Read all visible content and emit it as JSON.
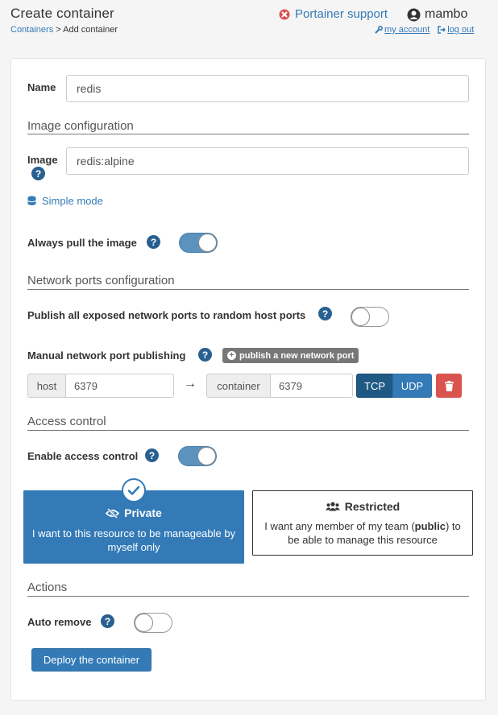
{
  "header": {
    "title": "Create container",
    "breadcrumb_link": "Containers",
    "breadcrumb_sep": ">",
    "breadcrumb_current": "Add container",
    "support": "Portainer support",
    "username": "mambo",
    "my_account": "my account",
    "log_out": "log out"
  },
  "form": {
    "name_label": "Name",
    "name_value": "redis",
    "image_section": "Image configuration",
    "image_label": "Image",
    "image_value": "redis:alpine",
    "simple_mode": "Simple mode",
    "always_pull_label": "Always pull the image",
    "always_pull": true
  },
  "network": {
    "section": "Network ports configuration",
    "publish_all_label": "Publish all exposed network ports to random host ports",
    "publish_all": false,
    "manual_label": "Manual network port publishing",
    "add_port": "publish a new network port",
    "ports": [
      {
        "host_label": "host",
        "host_value": "6379",
        "arrow": "→",
        "container_label": "container",
        "container_value": "6379",
        "tcp": "TCP",
        "udp": "UDP",
        "selected_protocol": "TCP"
      }
    ]
  },
  "access": {
    "section": "Access control",
    "enable_label": "Enable access control",
    "enabled": true,
    "private_title": "Private",
    "private_desc": "I want to this resource to be manageable by myself only",
    "restricted_title": "Restricted",
    "restricted_desc_1": "I want any member of my team (",
    "restricted_desc_bold": "public",
    "restricted_desc_2": ") to be able to manage this resource",
    "selected": "Private"
  },
  "actions": {
    "section": "Actions",
    "auto_remove_label": "Auto remove",
    "auto_remove": false,
    "deploy": "Deploy the container"
  },
  "colors": {
    "primary": "#337ab7",
    "danger": "#d9534f",
    "support_icon": "#d9534f"
  },
  "icons": [
    "times-circle-icon",
    "user-circle-icon",
    "wrench-icon",
    "sign-out-icon",
    "question-circle-icon",
    "database-icon",
    "plus-circle-icon",
    "arrow-right-icon",
    "trash-icon",
    "eye-slash-icon",
    "users-icon",
    "check-icon"
  ]
}
